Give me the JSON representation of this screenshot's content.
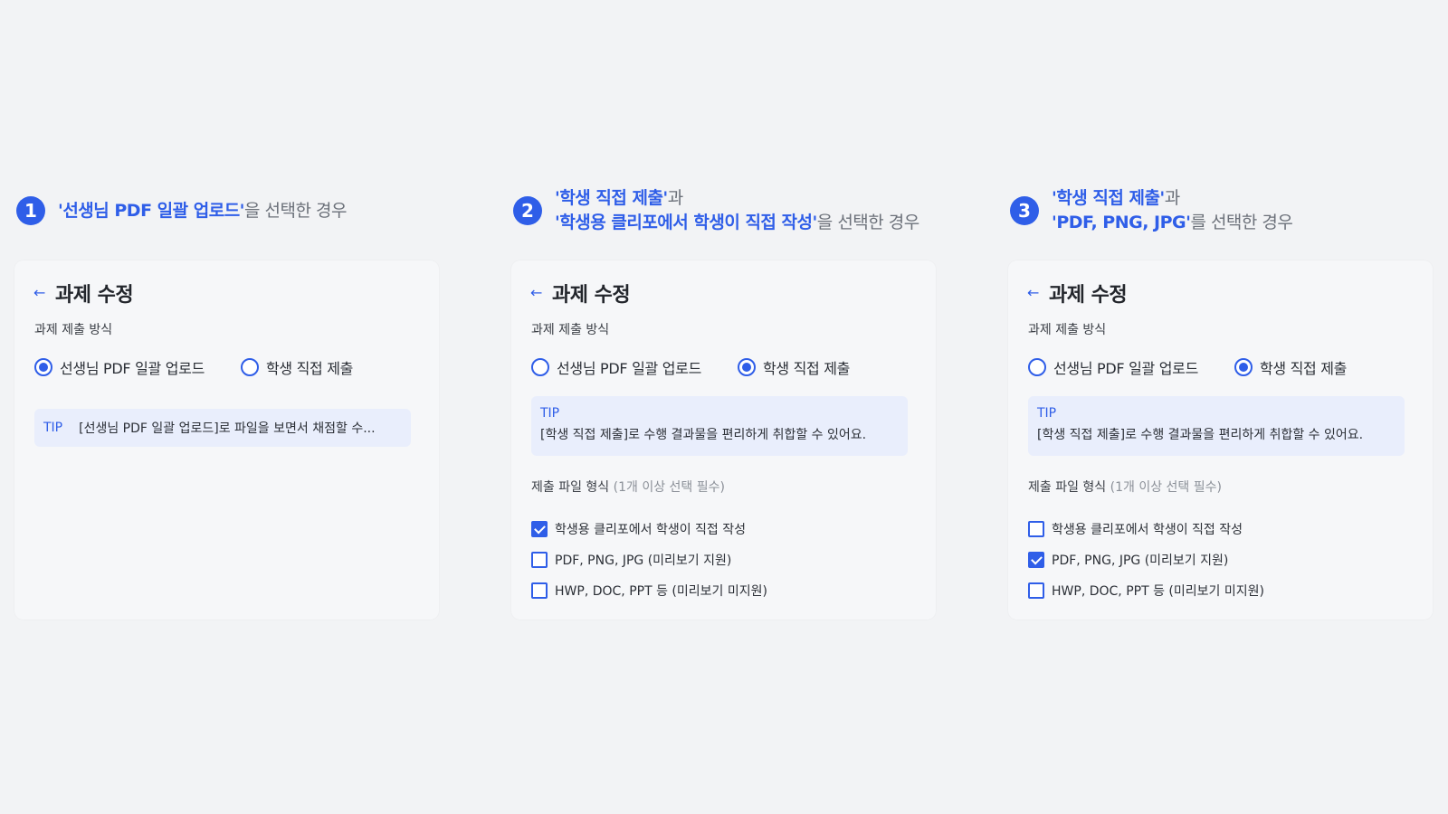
{
  "cases": [
    {
      "number": "1",
      "caption": {
        "hl1": "'선생님 PDF 일괄 업로드'",
        "rest1": "을 선택한 경우"
      },
      "title": "과제 수정",
      "submission_label": "과제 제출 방식",
      "radios": [
        "선생님 PDF 일괄 업로드",
        "학생 직접 제출"
      ],
      "selected_radio": 0,
      "tip_tag": "TIP",
      "tip_text": "[선생님 PDF 일괄 업로드]로 파일을 보면서 채점할 수..."
    },
    {
      "number": "2",
      "caption": {
        "hl1": "'학생 직접 제출'",
        "rest1": "과",
        "hl2": "'학생용 클리포에서 학생이 직접 작성'",
        "rest2": "을 선택한 경우"
      },
      "title": "과제 수정",
      "submission_label": "과제 제출 방식",
      "radios": [
        "선생님 PDF 일괄 업로드",
        "학생 직접 제출"
      ],
      "selected_radio": 1,
      "tip_tag": "TIP",
      "tip_text": "[학생 직접 제출]로 수행 결과물을 편리하게 취합할 수 있어요.",
      "format_label": "제출 파일 형식",
      "format_hint": "(1개 이상 선택 필수)",
      "checks": [
        {
          "label": "학생용 클리포에서 학생이 직접 작성",
          "checked": true
        },
        {
          "label": "PDF, PNG, JPG (미리보기 지원)",
          "checked": false
        },
        {
          "label": "HWP, DOC, PPT 등 (미리보기 미지원)",
          "checked": false
        }
      ]
    },
    {
      "number": "3",
      "caption": {
        "hl1": "'학생 직접 제출'",
        "rest1": "과",
        "hl2": "'PDF, PNG, JPG'",
        "rest2": "를 선택한 경우"
      },
      "title": "과제 수정",
      "submission_label": "과제 제출 방식",
      "radios": [
        "선생님 PDF 일괄 업로드",
        "학생 직접 제출"
      ],
      "selected_radio": 1,
      "tip_tag": "TIP",
      "tip_text": "[학생 직접 제출]로 수행 결과물을 편리하게 취합할 수 있어요.",
      "format_label": "제출 파일 형식",
      "format_hint": "(1개 이상 선택 필수)",
      "checks": [
        {
          "label": "학생용 클리포에서 학생이 직접 작성",
          "checked": false
        },
        {
          "label": "PDF, PNG, JPG (미리보기 지원)",
          "checked": true
        },
        {
          "label": "HWP, DOC, PPT 등 (미리보기 미지원)",
          "checked": false
        }
      ]
    }
  ],
  "colors": {
    "accent": "#2f5ee8",
    "tip_bg": "#e9eefc",
    "card_bg": "#f6f7f9",
    "page_bg": "#f2f3f5"
  },
  "icons": {
    "back": "arrow-left-icon"
  }
}
